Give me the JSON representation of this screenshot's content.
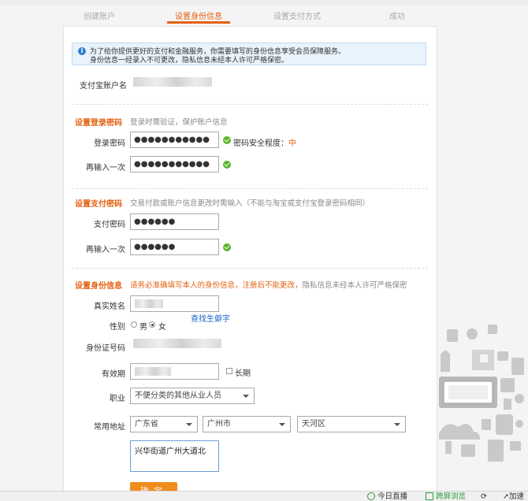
{
  "steps": [
    "创建账户",
    "设置身份信息",
    "设置支付方式",
    "成功"
  ],
  "active_step": 1,
  "notice": {
    "line1": "为了给你提供更好的支付和金融服务，你需要填写的身份信息享受会员保障服务。",
    "line2": "身份信息一经录入不可更改，隐私信息未经本人许可严格保密。"
  },
  "account_label": "支付宝账户名",
  "login_section": {
    "title": "设置登录密码",
    "hint": "登录时需验证，保护账户信息",
    "password_label": "登录密码",
    "password_value": "●●●●●●●●●●●",
    "strength_label": "密码安全程度：",
    "strength_level": "中",
    "confirm_label": "再输入一次",
    "confirm_value": "●●●●●●●●●●●"
  },
  "pay_section": {
    "title": "设置支付密码",
    "hint": "交易付款或账户信息更改时需输入（不能与淘宝或支付宝登录密码相同）",
    "password_label": "支付密码",
    "password_value": "●●●●●●",
    "confirm_label": "再输入一次",
    "confirm_value": "●●●●●●"
  },
  "identity_section": {
    "title": "设置身份信息",
    "hint_warn": "请务必准确填写本人的身份信息，注册后不能更改，",
    "hint_rest": "隐私信息未经本人许可严格保密",
    "name_label": "真实姓名",
    "rare_char_link": "查找生僻字",
    "gender_label": "性别",
    "gender_male": "男",
    "gender_female": "女",
    "gender_selected": "女",
    "id_label": "身份证号码",
    "validity_label": "有效期",
    "long_term_label": "长期",
    "job_label": "职业",
    "job_value": "不便分类的其他从业人员",
    "address_label": "常用地址",
    "province": "广东省",
    "city": "广州市",
    "district": "天河区",
    "address_detail": "兴华街道广州大道北"
  },
  "submit_label": "确定",
  "statusbar": {
    "live": "今日直播",
    "cross_screen": "跨屏浏览",
    "speed": "加速"
  },
  "colors": {
    "accent": "#e4600f",
    "link": "#1a66c4",
    "ok": "#5bb42c",
    "submit": "#f08c1c"
  }
}
